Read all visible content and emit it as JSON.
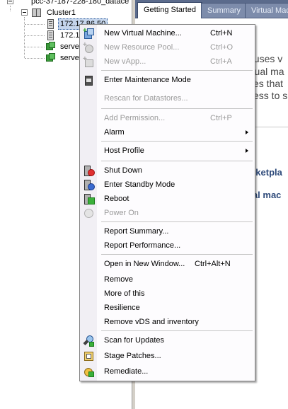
{
  "tree": {
    "datacenter_label": "pcc-37-187-228-180_datace",
    "cluster_label": "Cluster1",
    "hosts": [
      "172.17.86.50",
      "172.1"
    ],
    "vms": [
      "serve",
      "serve"
    ]
  },
  "tabs": [
    "Getting Started",
    "Summary",
    "Virtual Machi"
  ],
  "content_fragments": {
    "line1": "t uses v",
    "line2": "rtual ma",
    "line3": "ces that",
    "line4": "cess to s",
    "link1": "arketpla",
    "link2": "ual mac"
  },
  "menu": {
    "items": [
      {
        "label": "New Virtual Machine...",
        "shortcut": "Ctrl+N",
        "enabled": true,
        "icon": "new-vm-icon"
      },
      {
        "label": "New Resource Pool...",
        "shortcut": "Ctrl+O",
        "enabled": false,
        "icon": "new-resource-pool-icon"
      },
      {
        "label": "New vApp...",
        "shortcut": "Ctrl+A",
        "enabled": false,
        "icon": "new-vapp-icon"
      },
      {
        "label": "Enter Maintenance Mode",
        "shortcut": "",
        "enabled": true,
        "icon": "maintenance-mode-icon"
      },
      {
        "label": "Rescan for Datastores...",
        "shortcut": "",
        "enabled": false,
        "icon": ""
      },
      {
        "label": "Add Permission...",
        "shortcut": "Ctrl+P",
        "enabled": false,
        "icon": ""
      },
      {
        "label": "Alarm",
        "shortcut": "",
        "enabled": true,
        "icon": "",
        "submenu": true
      },
      {
        "label": "Host Profile",
        "shortcut": "",
        "enabled": true,
        "icon": "",
        "submenu": true
      },
      {
        "label": "Shut Down",
        "shortcut": "",
        "enabled": true,
        "icon": "shut-down-icon"
      },
      {
        "label": "Enter Standby Mode",
        "shortcut": "",
        "enabled": true,
        "icon": "standby-mode-icon"
      },
      {
        "label": "Reboot",
        "shortcut": "",
        "enabled": true,
        "icon": "reboot-icon"
      },
      {
        "label": "Power On",
        "shortcut": "",
        "enabled": false,
        "icon": "power-on-icon"
      },
      {
        "label": "Report Summary...",
        "shortcut": "",
        "enabled": true,
        "icon": ""
      },
      {
        "label": "Report Performance...",
        "shortcut": "",
        "enabled": true,
        "icon": ""
      },
      {
        "label": "Open in New Window...",
        "shortcut": "Ctrl+Alt+N",
        "enabled": true,
        "icon": ""
      },
      {
        "label": "Remove",
        "shortcut": "",
        "enabled": true,
        "icon": ""
      },
      {
        "label": "More of this",
        "shortcut": "",
        "enabled": true,
        "icon": ""
      },
      {
        "label": "Resilience",
        "shortcut": "",
        "enabled": true,
        "icon": ""
      },
      {
        "label": "Remove vDS and inventory",
        "shortcut": "",
        "enabled": true,
        "icon": ""
      },
      {
        "label": "Scan for Updates",
        "shortcut": "",
        "enabled": true,
        "icon": "scan-updates-icon"
      },
      {
        "label": "Stage Patches...",
        "shortcut": "",
        "enabled": true,
        "icon": "stage-patches-icon"
      },
      {
        "label": "Remediate...",
        "shortcut": "",
        "enabled": true,
        "icon": "remediate-icon"
      }
    ]
  }
}
